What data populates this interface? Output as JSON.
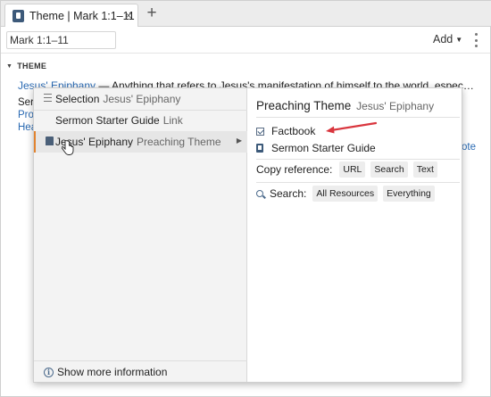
{
  "tab": {
    "title": "Theme | Mark 1:1–11",
    "close": "×",
    "add": "+"
  },
  "toolbar": {
    "reference_value": "Mark 1:1–11",
    "add_label": "Add"
  },
  "section": {
    "heading": "THEME"
  },
  "theme": {
    "link": "Jesus' Epiphany",
    "description": " — Anything that refers to Jesus's manifestation of himself to the world, especially regardi…"
  },
  "background": {
    "ser": "Ser",
    "pro": "Pro",
    "hea": "Hea",
    "ote": "ote"
  },
  "menu": {
    "items": [
      {
        "label": "Selection",
        "sub": "Jesus' Epiphany"
      },
      {
        "label": "Sermon Starter Guide",
        "sub": "Link"
      },
      {
        "label": "Jesus' Epiphany",
        "sub": "Preaching Theme"
      }
    ],
    "more_info": "Show more information"
  },
  "submenu": {
    "title": "Preaching Theme",
    "subtitle": "Jesus' Epiphany",
    "items": [
      "Factbook",
      "Sermon Starter Guide"
    ],
    "copy_label": "Copy reference:",
    "copy_chips": [
      "URL",
      "Search",
      "Text"
    ],
    "search_label": "Search:",
    "search_chips": [
      "All Resources",
      "Everything"
    ]
  },
  "colors": {
    "link": "#2a6ab3",
    "accent": "#e2832f",
    "annotation_arrow": "#d9363e"
  }
}
